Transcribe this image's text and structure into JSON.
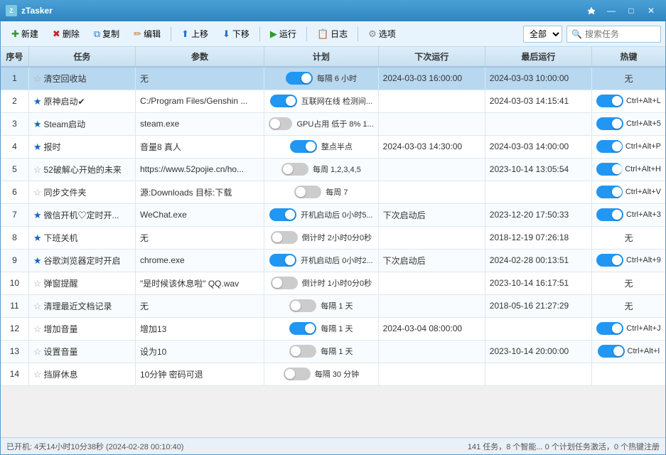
{
  "titleBar": {
    "icon": "✓",
    "title": "zTasker",
    "minimizeLabel": "—",
    "maximizeLabel": "□",
    "closeLabel": "✕",
    "controls": {
      "pin": "📌",
      "minimize": "—",
      "maximize": "□",
      "close": "✕"
    }
  },
  "toolbar": {
    "newLabel": "新建",
    "deleteLabel": "删除",
    "copyLabel": "复制",
    "editLabel": "编辑",
    "upLabel": "上移",
    "downLabel": "下移",
    "runLabel": "运行",
    "logLabel": "日志",
    "optionsLabel": "选项",
    "filterOptions": [
      "全部"
    ],
    "filterDefault": "全部",
    "searchPlaceholder": "搜索任务"
  },
  "tableHeaders": {
    "no": "序号",
    "task": "任务",
    "param": "参数",
    "plan": "计划",
    "next": "下次运行",
    "last": "最后运行",
    "hotkey": "热键"
  },
  "rows": [
    {
      "no": 1,
      "star": "empty",
      "task": "清空回收站",
      "param": "无",
      "planToggle": "on",
      "planText": "每隔 6 小时",
      "next": "2024-03-03 16:00:00",
      "last": "2024-03-03 10:00:00",
      "hotkeyToggle": "",
      "hotkeyText": "无",
      "selected": true
    },
    {
      "no": 2,
      "star": "filled",
      "task": "原神启动✔",
      "param": "C:/Program Files/Genshin ...",
      "planToggle": "on",
      "planText": "互联网在线 检测间...",
      "next": "",
      "last": "2024-03-03 14:15:41",
      "hotkeyToggle": "on",
      "hotkeyText": "Ctrl+Alt+L",
      "selected": false
    },
    {
      "no": 3,
      "star": "filled",
      "task": "Steam启动",
      "param": "steam.exe",
      "planToggle": "off",
      "planText": "GPU占用 低于 8% 1...",
      "next": "",
      "last": "",
      "hotkeyToggle": "on",
      "hotkeyText": "Ctrl+Alt+5",
      "selected": false
    },
    {
      "no": 4,
      "star": "filled",
      "task": "报时",
      "param": "音量8 真人",
      "planToggle": "on",
      "planText": "整点半点",
      "next": "2024-03-03 14:30:00",
      "last": "2024-03-03 14:00:00",
      "hotkeyToggle": "on",
      "hotkeyText": "Ctrl+Alt+P",
      "selected": false
    },
    {
      "no": 5,
      "star": "empty",
      "task": "52破解心开始的未来",
      "param": "https://www.52pojie.cn/ho...",
      "planToggle": "off",
      "planText": "每周 1,2,3,4,5",
      "next": "",
      "last": "2023-10-14 13:05:54",
      "hotkeyToggle": "on",
      "hotkeyText": "Ctrl+Alt+H",
      "selected": false
    },
    {
      "no": 6,
      "star": "empty",
      "task": "同步文件夹",
      "param": "源:Downloads 目标:下载",
      "planToggle": "off",
      "planText": "每周 7",
      "next": "",
      "last": "",
      "hotkeyToggle": "on",
      "hotkeyText": "Ctrl+Alt+V",
      "selected": false
    },
    {
      "no": 7,
      "star": "filled",
      "task": "微信开机♡定时开...",
      "param": "WeChat.exe",
      "planToggle": "on",
      "planText": "开机启动后 0小时5...",
      "next": "下次启动后",
      "last": "2023-12-20 17:50:33",
      "hotkeyToggle": "on",
      "hotkeyText": "Ctrl+Alt+3",
      "selected": false
    },
    {
      "no": 8,
      "star": "filled",
      "task": "下班关机",
      "param": "无",
      "planToggle": "off",
      "planText": "倒计时 2小时0分0秒",
      "next": "",
      "last": "2018-12-19 07:26:18",
      "hotkeyToggle": "",
      "hotkeyText": "无",
      "selected": false
    },
    {
      "no": 9,
      "star": "filled",
      "task": "谷歌浏览器定时开启",
      "param": "chrome.exe",
      "planToggle": "on",
      "planText": "开机启动后 0小时2...",
      "next": "下次启动后",
      "last": "2024-02-28 00:13:51",
      "hotkeyToggle": "on",
      "hotkeyText": "Ctrl+Alt+9",
      "selected": false
    },
    {
      "no": 10,
      "star": "empty",
      "task": "弹窗提醒",
      "param": "\"是时候该休息啦\" QQ.wav",
      "planToggle": "off",
      "planText": "倒计时 1小时0分0秒",
      "next": "",
      "last": "2023-10-14 16:17:51",
      "hotkeyToggle": "",
      "hotkeyText": "无",
      "selected": false
    },
    {
      "no": 11,
      "star": "empty",
      "task": "清理最近文档记录",
      "param": "无",
      "planToggle": "off",
      "planText": "每隔 1 天",
      "next": "",
      "last": "2018-05-16 21:27:29",
      "hotkeyToggle": "",
      "hotkeyText": "无",
      "selected": false
    },
    {
      "no": 12,
      "star": "empty",
      "task": "增加音量",
      "param": "增加13",
      "planToggle": "on",
      "planText": "每隔 1 天",
      "next": "2024-03-04 08:00:00",
      "last": "",
      "hotkeyToggle": "on",
      "hotkeyText": "Ctrl+Alt+J",
      "selected": false
    },
    {
      "no": 13,
      "star": "empty",
      "task": "设置音量",
      "param": "设为10",
      "planToggle": "off",
      "planText": "每隔 1 天",
      "next": "",
      "last": "2023-10-14 20:00:00",
      "hotkeyToggle": "on",
      "hotkeyText": "Ctrl+Alt+I",
      "selected": false
    },
    {
      "no": 14,
      "star": "empty",
      "task": "挡屏休息",
      "param": "10分钟 密码可退",
      "planToggle": "off",
      "planText": "每隔 30 分钟",
      "next": "",
      "last": "",
      "hotkeyToggle": "",
      "hotkeyText": "",
      "selected": false
    }
  ],
  "statusBar": {
    "uptime": "已开机: 4天14小时10分38秒 (2024-02-28 00:10:40)",
    "taskCount": "141 任务",
    "taskStats": "8 个智能..."
  },
  "colors": {
    "accent": "#2196F3",
    "headerBg": "#ddeefa",
    "selectedRow": "#b8d8f0",
    "titleBarBg": "#3a8fc5"
  }
}
